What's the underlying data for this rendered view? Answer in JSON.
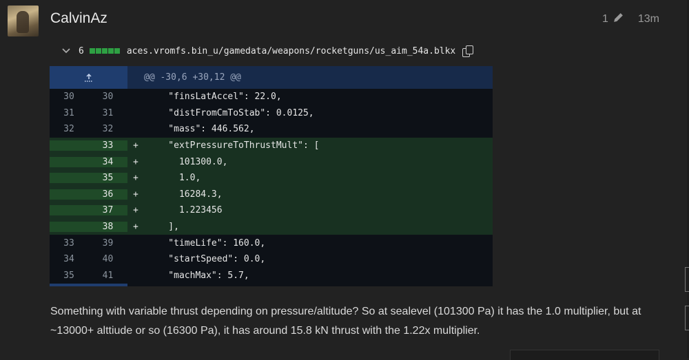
{
  "post": {
    "username": "CalvinAz",
    "edit_count": "1",
    "time": "13m",
    "body": "Something with variable thrust depending on pressure/altitude? So at sealevel (101300 Pa) it has the 1.0 multiplier, but at ~13000+ alttiude or so (16300 Pa), it has around 15.8 kN thrust with the 1.22x multiplier."
  },
  "diff": {
    "changes": "6",
    "file_path": "aces.vromfs.bin_u/gamedata/weapons/rocketguns/us_aim_54a.blkx",
    "hunk_header": "@@ -30,6 +30,12 @@",
    "expand_icon": "expand-up-icon",
    "lines": [
      {
        "old": "30",
        "new": "30",
        "sign": "",
        "type": "context",
        "code": "    \"finsLatAccel\": 22.0,"
      },
      {
        "old": "31",
        "new": "31",
        "sign": "",
        "type": "context",
        "code": "    \"distFromCmToStab\": 0.0125,"
      },
      {
        "old": "32",
        "new": "32",
        "sign": "",
        "type": "context",
        "code": "    \"mass\": 446.562,"
      },
      {
        "old": "",
        "new": "33",
        "sign": "+",
        "type": "add",
        "code": "    \"extPressureToThrustMult\": ["
      },
      {
        "old": "",
        "new": "34",
        "sign": "+",
        "type": "add",
        "code": "      101300.0,"
      },
      {
        "old": "",
        "new": "35",
        "sign": "+",
        "type": "add",
        "code": "      1.0,"
      },
      {
        "old": "",
        "new": "36",
        "sign": "+",
        "type": "add",
        "code": "      16284.3,"
      },
      {
        "old": "",
        "new": "37",
        "sign": "+",
        "type": "add",
        "code": "      1.223456"
      },
      {
        "old": "",
        "new": "38",
        "sign": "+",
        "type": "add",
        "code": "    ],"
      },
      {
        "old": "33",
        "new": "39",
        "sign": "",
        "type": "context",
        "code": "    \"timeLife\": 160.0,"
      },
      {
        "old": "34",
        "new": "40",
        "sign": "",
        "type": "context",
        "code": "    \"startSpeed\": 0.0,"
      },
      {
        "old": "35",
        "new": "41",
        "sign": "",
        "type": "context",
        "code": "    \"machMax\": 5.7,"
      }
    ]
  },
  "colors": {
    "addition": "#183121",
    "addition_gutter": "#1f4a28",
    "hunk": "#172a4a",
    "diffstat": "#2ea043"
  }
}
